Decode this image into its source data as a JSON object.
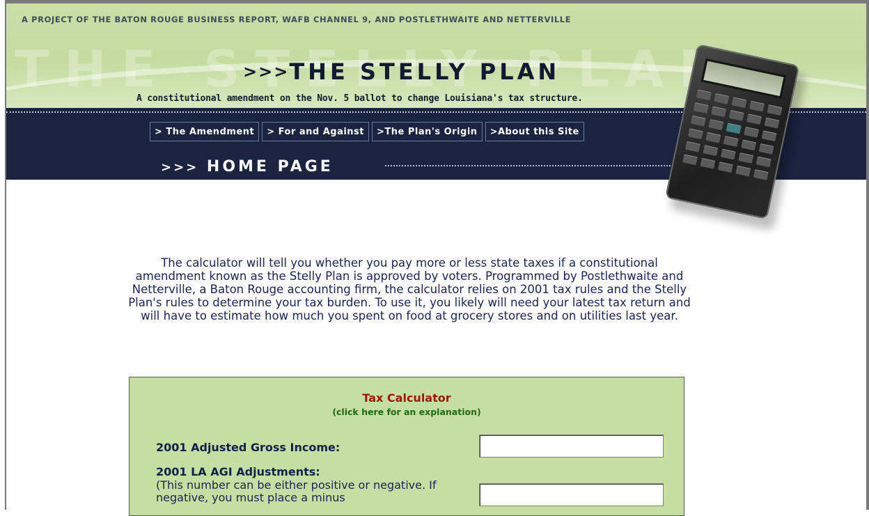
{
  "header": {
    "project_line": "A PROJECT OF THE BATON ROUGE BUSINESS REPORT, WAFB CHANNEL 9, AND POSTLETHWAITE AND NETTERVILLE",
    "ghost_title": "THE STELLY PLAN",
    "title_prefix": ">>>",
    "title": "THE STELLY PLAN",
    "subtitle": "A constitutional amendment on the Nov. 5 ballot to change Louisiana's tax structure."
  },
  "nav": {
    "items": [
      {
        "label": "> The Amendment"
      },
      {
        "label": "> For and Against"
      },
      {
        "label": ">The Plan's Origin"
      },
      {
        "label": ">About this Site"
      }
    ]
  },
  "page_heading": {
    "prefix": ">>>",
    "text": "HOME PAGE"
  },
  "intro": "The calculator will tell you whether you pay more or less state taxes if a constitutional amendment known as the Stelly Plan is approved by voters. Programmed by Postlethwaite and Netterville, a Baton Rouge accounting firm, the calculator relies on 2001 tax rules and the Stelly Plan's rules to determine your tax burden. To use it, you likely will need your latest tax return and will have to estimate how much you spent on food at grocery stores and on utilities last year.",
  "calculator": {
    "title": "Tax Calculator",
    "explain_link": "(click here for an explanation)",
    "fields": [
      {
        "label": "2001 Adjusted Gross Income:",
        "value": ""
      },
      {
        "label": "2001 LA AGI Adjustments:",
        "note": "(This number can be either positive or negative. If negative, you must place a minus",
        "value": ""
      }
    ]
  },
  "colors": {
    "banner_green": "#c4dca0",
    "navy": "#1a2340",
    "title_red": "#a3140d",
    "link_green": "#1b6a16",
    "panel_green": "#c5dea2"
  }
}
